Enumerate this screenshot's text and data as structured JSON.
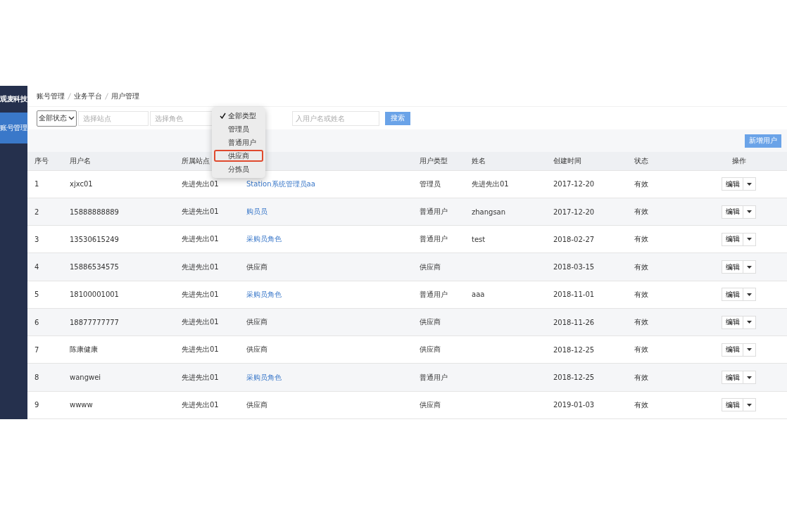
{
  "sidebar": {
    "logo": "观麦科技",
    "items": [
      {
        "label": "账号管理",
        "selected": true
      }
    ]
  },
  "breadcrumb": [
    "账号管理",
    "业务平台",
    "用户管理"
  ],
  "filters": {
    "status_select": "全部状态",
    "site_field": {
      "placeholder": "选择站点"
    },
    "role_field": {
      "placeholder": "选择角色"
    },
    "keyword_field": {
      "placeholder": "入用户名或姓名"
    },
    "search_button": "搜索"
  },
  "type_menu": {
    "options": [
      {
        "label": "全部类型",
        "selected": true,
        "focused": false
      },
      {
        "label": "管理员",
        "selected": false,
        "focused": false
      },
      {
        "label": "普通用户",
        "selected": false,
        "focused": false
      },
      {
        "label": "供应商",
        "selected": false,
        "focused": true
      },
      {
        "label": "分拣员",
        "selected": false,
        "focused": false
      }
    ]
  },
  "add_button": "新增用户",
  "table": {
    "columns": [
      "序号",
      "用户名",
      "所属站点",
      "",
      "用户类型",
      "姓名",
      "创建时间",
      "状态",
      "操作"
    ],
    "rows": [
      {
        "index": "1",
        "username": "xjxc01",
        "site": "先进先出01",
        "role": "Station系统管理员aa",
        "role_linked": true,
        "type": "管理员",
        "name": "先进先出01",
        "created": "2017-12-20",
        "status": "有效",
        "edit": "编辑"
      },
      {
        "index": "2",
        "username": "15888888889",
        "site": "先进先出01",
        "role": "购员员",
        "role_linked": true,
        "type": "普通用户",
        "name": "zhangsan",
        "created": "2017-12-20",
        "status": "有效",
        "edit": "编辑"
      },
      {
        "index": "3",
        "username": "13530615249",
        "site": "先进先出01",
        "role": "采购员角色",
        "role_linked": true,
        "type": "普通用户",
        "name": "test",
        "created": "2018-02-27",
        "status": "有效",
        "edit": "编辑"
      },
      {
        "index": "4",
        "username": "15886534575",
        "site": "先进先出01",
        "role": "供应商",
        "role_linked": false,
        "type": "供应商",
        "name": "",
        "created": "2018-03-15",
        "status": "有效",
        "edit": "编辑"
      },
      {
        "index": "5",
        "username": "18100001001",
        "site": "先进先出01",
        "role": "采购员角色",
        "role_linked": true,
        "type": "普通用户",
        "name": "aaa",
        "created": "2018-11-01",
        "status": "有效",
        "edit": "编辑"
      },
      {
        "index": "6",
        "username": "18877777777",
        "site": "先进先出01",
        "role": "供应商",
        "role_linked": false,
        "type": "供应商",
        "name": "",
        "created": "2018-11-26",
        "status": "有效",
        "edit": "编辑"
      },
      {
        "index": "7",
        "username": "陈康健康",
        "site": "先进先出01",
        "role": "供应商",
        "role_linked": false,
        "type": "供应商",
        "name": "",
        "created": "2018-12-25",
        "status": "有效",
        "edit": "编辑"
      },
      {
        "index": "8",
        "username": "wangwei",
        "site": "先进先出01",
        "role": "采购员角色",
        "role_linked": true,
        "type": "普通用户",
        "name": "",
        "created": "2018-12-25",
        "status": "有效",
        "edit": "编辑"
      },
      {
        "index": "9",
        "username": "wwww",
        "site": "先进先出01",
        "role": "供应商",
        "role_linked": false,
        "type": "供应商",
        "name": "",
        "created": "2019-01-03",
        "status": "有效",
        "edit": "编辑"
      }
    ]
  }
}
